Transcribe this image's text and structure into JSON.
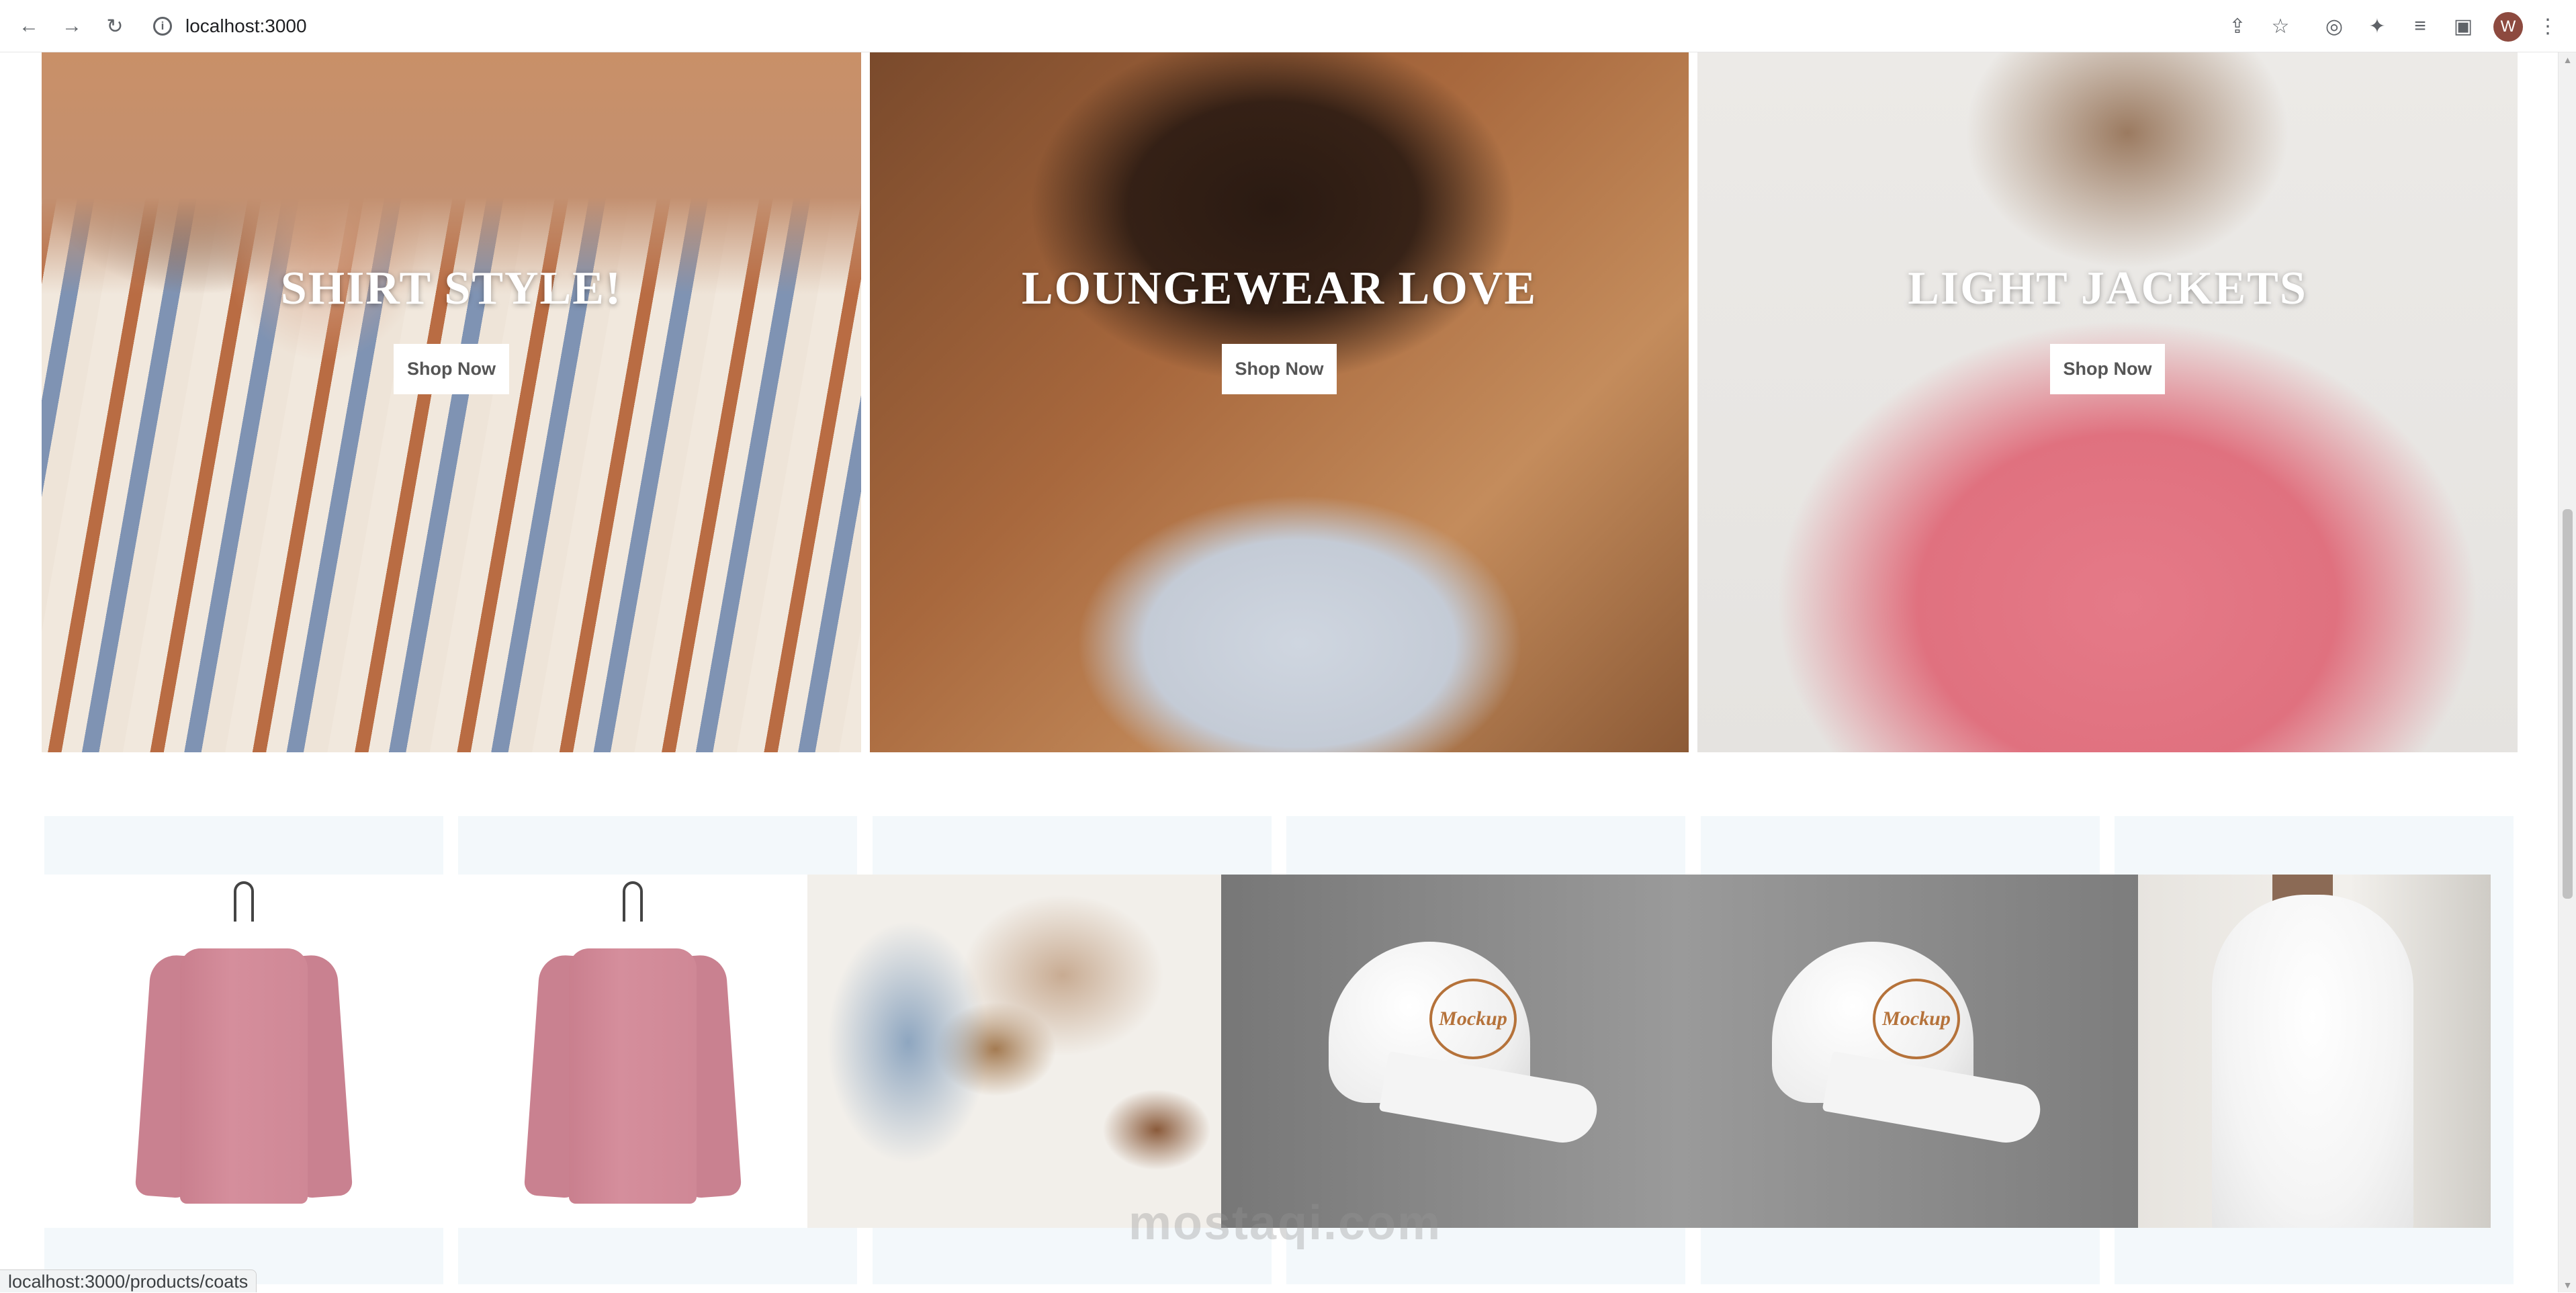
{
  "browser": {
    "url": "localhost:3000",
    "avatar_initial": "W"
  },
  "heroes": [
    {
      "title": "SHIRT STYLE!",
      "button": "Shop Now"
    },
    {
      "title": "LOUNGEWEAR LOVE",
      "button": "Shop Now"
    },
    {
      "title": "LIGHT JACKETS",
      "button": "Shop Now"
    }
  ],
  "products": [
    {
      "image": "pink-sweater"
    },
    {
      "image": "pink-sweater"
    },
    {
      "image": "outfit-flatlay"
    },
    {
      "image": "white-cap",
      "logo": "Mockup"
    },
    {
      "image": "white-cap",
      "logo": "Mockup"
    },
    {
      "image": "white-hoodie"
    }
  ],
  "watermark": "mostaqi.com",
  "status_url": "localhost:3000/products/coats",
  "colors": {
    "hero_title": "#ffffff",
    "button_bg": "#ffffff",
    "button_text": "#555555",
    "card_bg": "#f3f8fb"
  }
}
